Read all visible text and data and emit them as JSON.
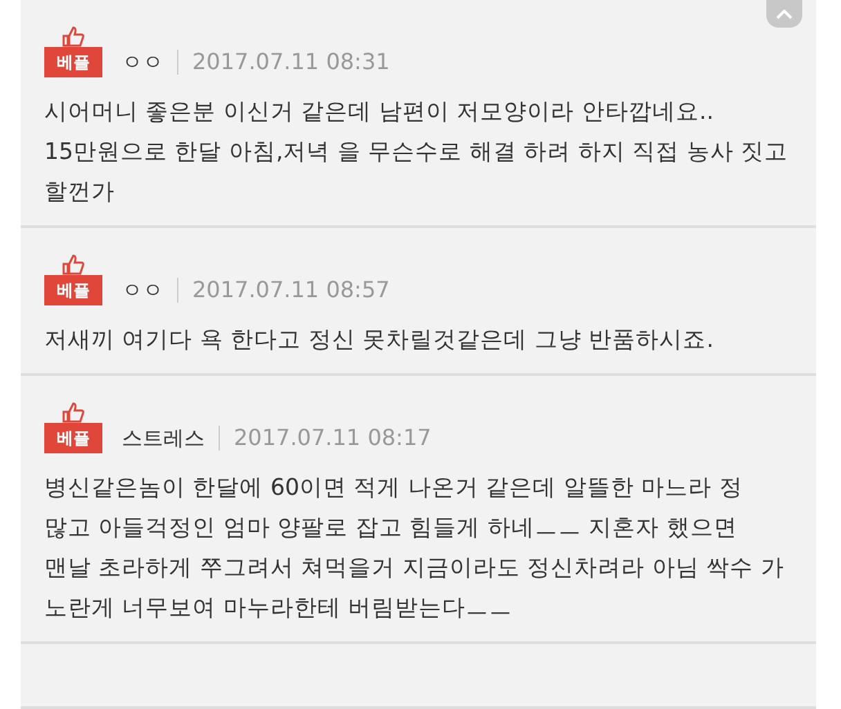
{
  "comments": [
    {
      "badge": "베플",
      "author": "ㅇㅇ",
      "date": "2017.07.11 08:31",
      "text": "시어머니 좋은분 이신거 같은데 남편이 저모양이라 안타깝네요.. 15만원으로 한달 아침,저녁 을 무슨수로 해결 하려 하지 직접 농사 짓고 할껀가"
    },
    {
      "badge": "베플",
      "author": "ㅇㅇ",
      "date": "2017.07.11 08:57",
      "text": "저새끼 여기다 욕 한다고 정신 못차릴것같은데 그냥 반품하시죠."
    },
    {
      "badge": "베플",
      "author": "스트레스",
      "date": "2017.07.11 08:17",
      "text": "병신같은놈이 한달에 60이면 적게 나온거 같은데 알뜰한 마느라 정 많고 아들걱정인 엄마 양팔로 잡고 힘들게 하네ㅡㅡ 지혼자 했으면 맨날 초라하게 쭈그려서 쳐먹을거 지금이라도 정신차려라 아님 싹수 가 노란게 너무보여 마누라한테 버림받는다ㅡㅡ"
    }
  ]
}
